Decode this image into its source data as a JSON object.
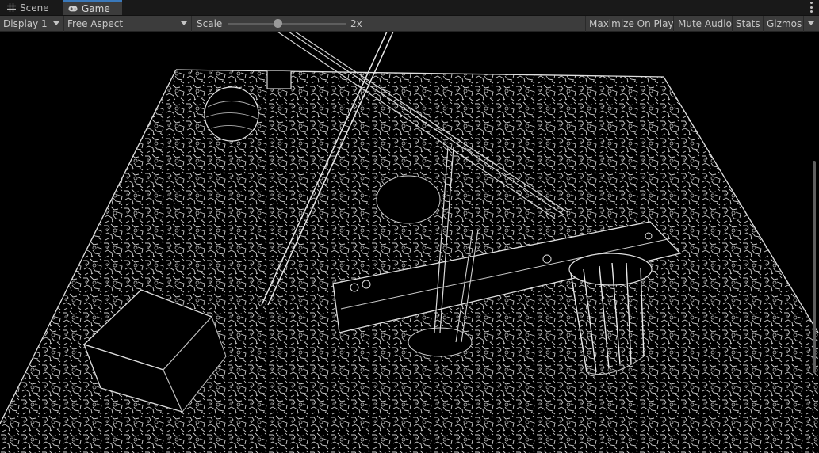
{
  "tabs": [
    {
      "label": "Scene",
      "icon": "grid-icon"
    },
    {
      "label": "Game",
      "icon": "gamepad-icon"
    }
  ],
  "toolbar": {
    "display": "Display 1",
    "aspect": "Free Aspect",
    "scale_label": "Scale",
    "scale_value": "2x",
    "maximize": "Maximize On Play",
    "mute": "Mute Audio",
    "stats": "Stats",
    "gizmos": "Gizmos"
  },
  "colors": {
    "accent": "#3a79bb",
    "panel": "#3c3c3c",
    "background": "#191919",
    "viewport": "#000000",
    "edge": "#d9d9d9"
  }
}
